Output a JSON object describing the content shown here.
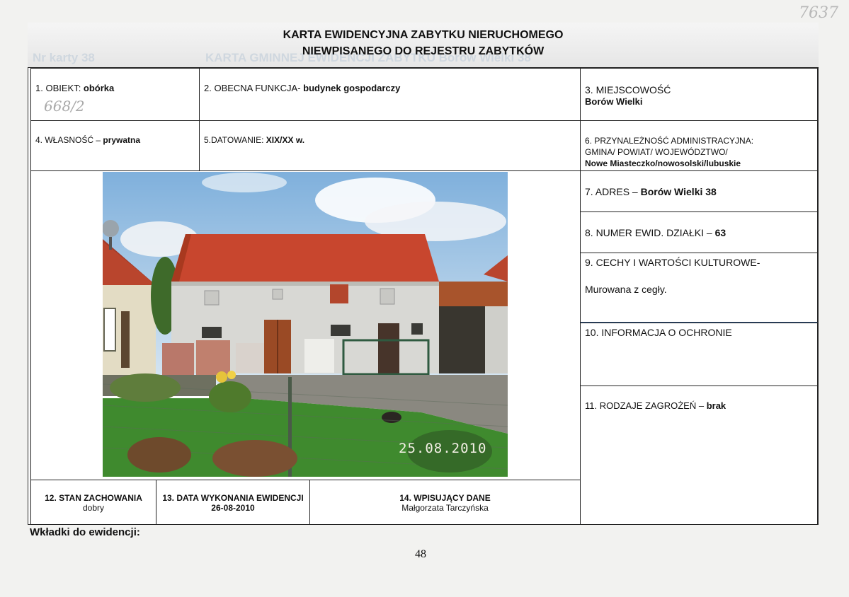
{
  "handwritten_corner": "7637",
  "header": {
    "title_line1": "KARTA EWIDENCYJNA ZABYTKU NIERUCHOMEGO",
    "title_line2": "NIEWPISANEGO DO REJESTRU ZABYTKÓW",
    "ghost_left": "Nr karty 38",
    "ghost_right": "KARTA GMINNEJ EWIDENCJI ZABYTKU Borów Wielki 38"
  },
  "fields": {
    "f1_label": "1. OBIEKT: ",
    "f1_value": "obórka",
    "f1_handwritten": "668/2",
    "f2_label": "2. OBECNA FUNKCJA- ",
    "f2_value": "budynek gospodarczy",
    "f3_label": "3. MIEJSCOWOŚĆ",
    "f3_value": "Borów Wielki",
    "f4_label": "4. WŁASNOŚĆ – ",
    "f4_value": "prywatna",
    "f5_label": "5.DATOWANIE: ",
    "f5_value": "XIX/XX w.",
    "f6_label_line1": "6. PRZYNALEŻNOŚĆ ADMINISTRACYJNA:",
    "f6_label_line2": "GMINA/ POWIAT/ WOJEWÓDZTWO/",
    "f6_value": "Nowe Miasteczko/nowosolski/lubuskie",
    "f7_label": "7. ADRES – ",
    "f7_value": "Borów Wielki 38",
    "f8_label": "8. NUMER EWID. DZIAŁKI – ",
    "f8_value": "63",
    "f9_label": "9. CECHY  I WARTOŚCI KULTUROWE-",
    "f9_value": "Murowana z cegły.",
    "f10_label": "10. INFORMACJA O OCHRONIE",
    "f11_label": "11. RODZAJE ZAGROŻEŃ – ",
    "f11_value": "brak",
    "f12_label": "12. STAN ZACHOWANIA",
    "f12_value": "dobry",
    "f13_label": "13. DATA WYKONANIA EWIDENCJI",
    "f13_value": "26-08-2010",
    "f14_label": "14. WPISUJĄCY DANE",
    "f14_value": "Małgorzata Tarczyńska"
  },
  "photo": {
    "date_stamp": "25.08.2010",
    "colors": {
      "sky": "#a9cbe8",
      "roof": "#c8462e",
      "wall": "#d8d8d4",
      "grass": "#3f8a2e",
      "door": "#9a4a25"
    }
  },
  "footer": {
    "inserts_label": "Wkładki do ewidencji:",
    "page_number": "48"
  }
}
